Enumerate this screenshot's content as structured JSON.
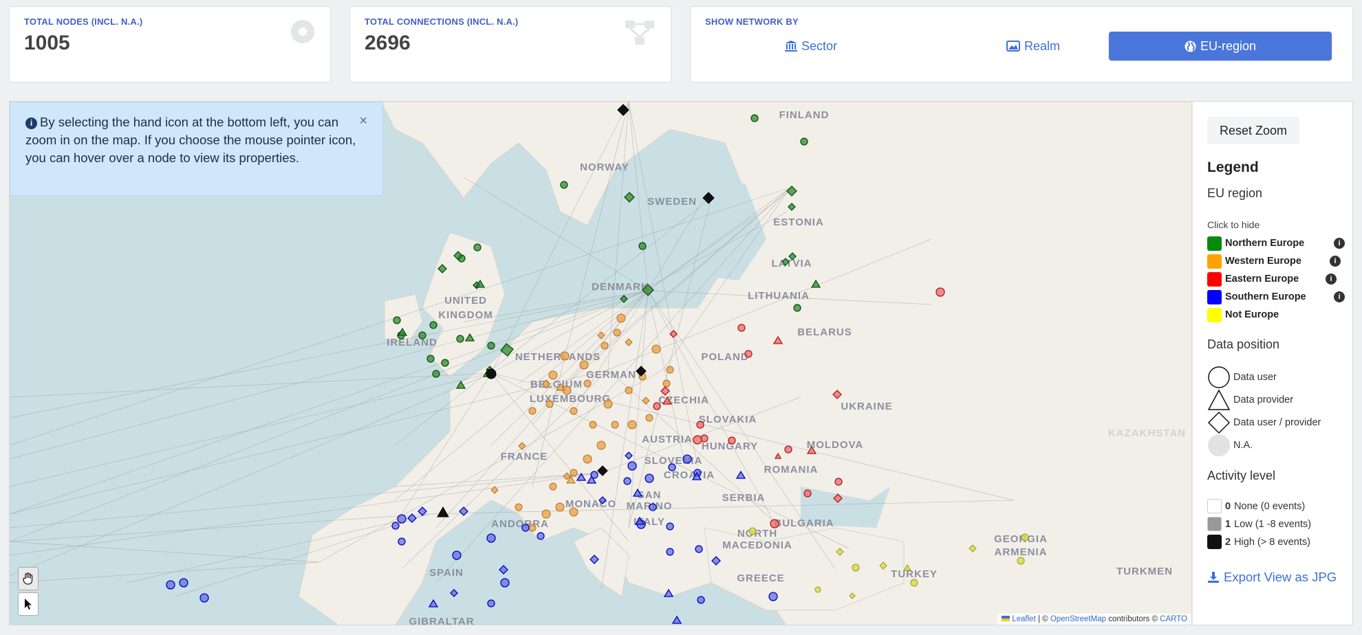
{
  "stats": {
    "nodes_label": "TOTAL NODES (INCL. N.A.)",
    "nodes_value": "1005",
    "connections_label": "TOTAL CONNECTIONS (INCL. N.A.)",
    "connections_value": "2696"
  },
  "network_by": {
    "label": "SHOW NETWORK BY",
    "options": [
      {
        "label": "Sector",
        "icon": "bank-icon",
        "active": false
      },
      {
        "label": "Realm",
        "icon": "image-icon",
        "active": false
      },
      {
        "label": "EU-region",
        "icon": "globe-icon",
        "active": true
      }
    ]
  },
  "info_banner": {
    "text": "By selecting the hand icon at the bottom left, you can zoom in on the map. If you choose the mouse pointer icon, you can hover over a node to view its properties.",
    "close": "×"
  },
  "map": {
    "countries": [
      "FINLAND",
      "NORWAY",
      "SWEDEN",
      "ESTONIA",
      "LATVIA",
      "LITHUANIA",
      "DENMARK",
      "UNITED",
      "KINGDOM",
      "IRELAND",
      "BELARUS",
      "POLAND",
      "NETHERLANDS",
      "BELGIUM",
      "LUXEMBOURG",
      "GERMANY",
      "CZECHIA",
      "UKRAINE",
      "SLOVAKIA",
      "MOLDOVA",
      "AUSTRIA",
      "HUNGARY",
      "SLOVENIA",
      "CROATIA",
      "ROMANIA",
      "FRANCE",
      "SERBIA",
      "MONACO",
      "SAN",
      "MARINO",
      "BULGARIA",
      "ANDORRA",
      "ITALY",
      "NORTH",
      "MACEDONIA",
      "GEORGIA",
      "ARMENIA",
      "SPAIN",
      "TURKEY",
      "GREECE",
      "GIBRALTAR",
      "TURKMEN",
      "KAZAKHSTAN"
    ],
    "attribution": {
      "leaflet": "Leaflet",
      "sep1": " | © ",
      "osm": "OpenStreetMap",
      "mid": " contributors © ",
      "carto": "CARTO"
    }
  },
  "panel": {
    "reset_zoom": "Reset Zoom",
    "legend_title": "Legend",
    "eu_region_title": "EU region",
    "click_to_hide": "Click to hide",
    "regions": [
      {
        "label": "Northern Europe",
        "color": "#0a8a0a",
        "info": true
      },
      {
        "label": "Western Europe",
        "color": "#ffa200",
        "info": true
      },
      {
        "label": "Eastern Europe",
        "color": "#ff0000",
        "info": true
      },
      {
        "label": "Southern Europe",
        "color": "#0000ff",
        "info": true
      },
      {
        "label": "Not Europe",
        "color": "#ffff00",
        "info": false
      }
    ],
    "data_position_title": "Data position",
    "positions": [
      "Data user",
      "Data provider",
      "Data user / provider",
      "N.A."
    ],
    "activity_title": "Activity level",
    "activity": [
      {
        "level": "0",
        "label": "None (0 events)",
        "color": "#ffffff"
      },
      {
        "level": "1",
        "label": "Low (1 -8 events)",
        "color": "#999999"
      },
      {
        "level": "2",
        "label": "High (> 8 events)",
        "color": "#111111"
      }
    ],
    "export": "Export View as JPG"
  }
}
